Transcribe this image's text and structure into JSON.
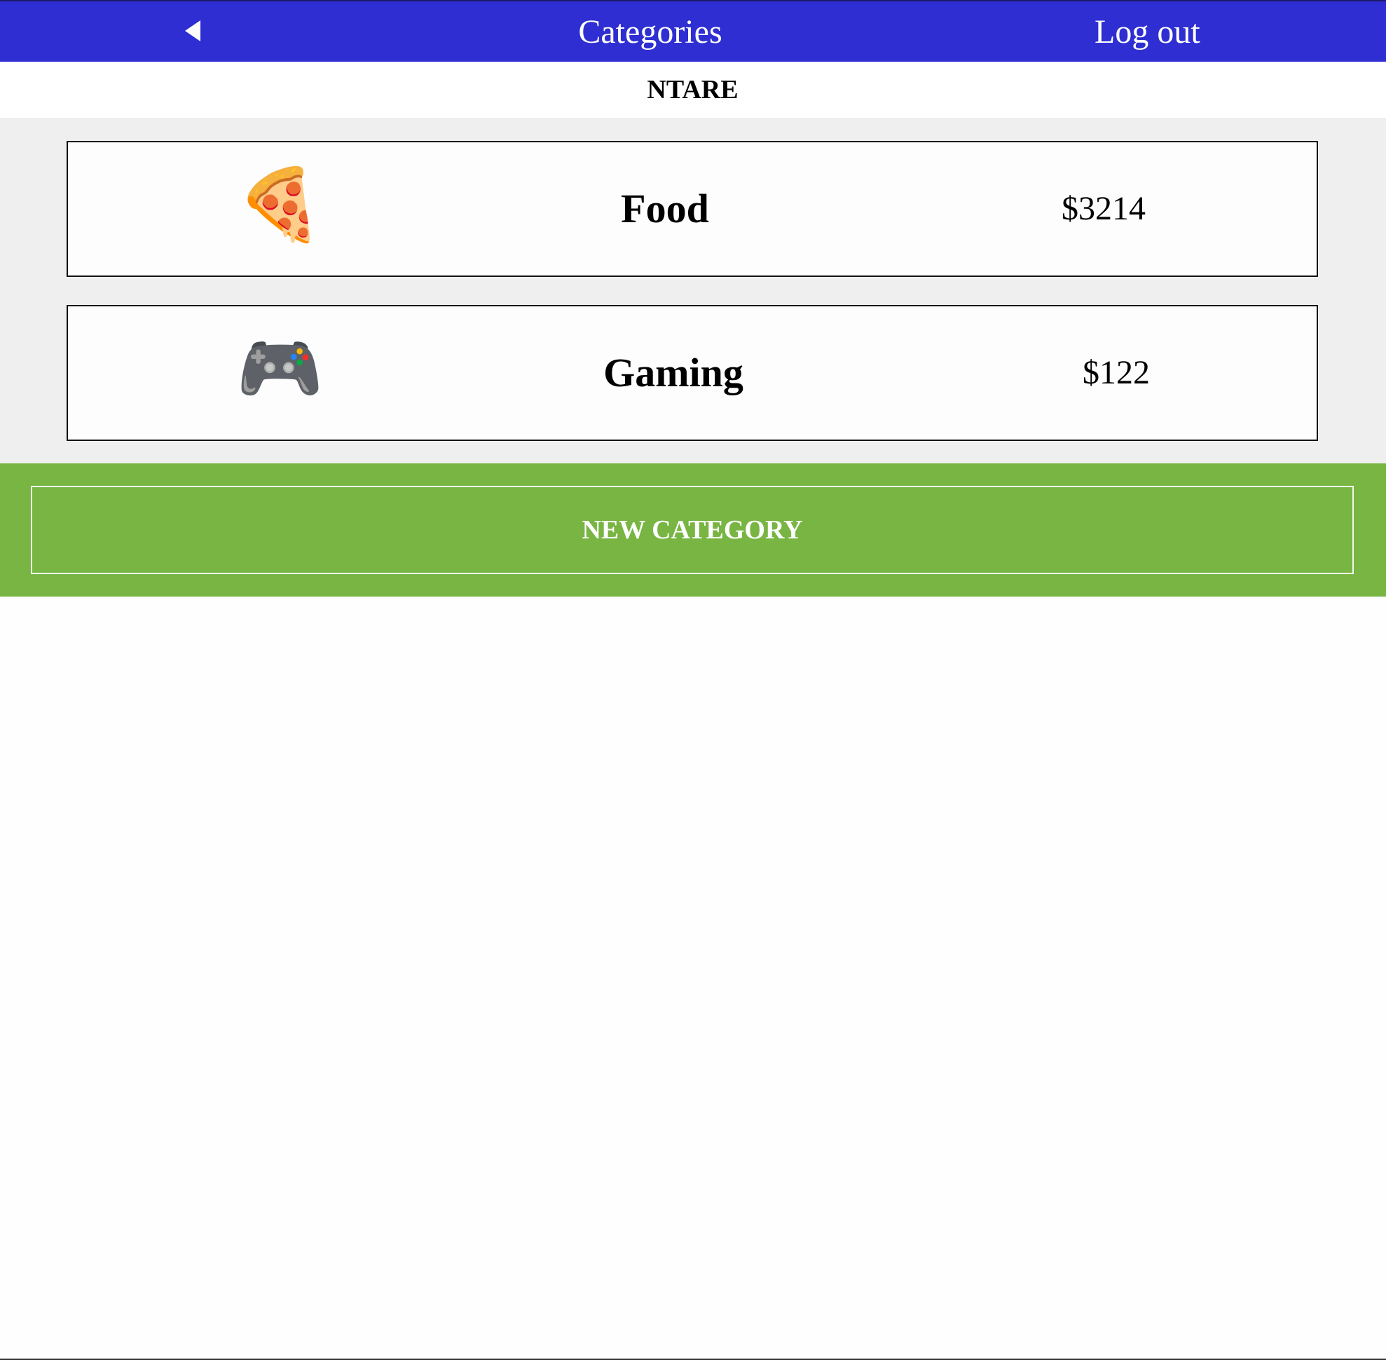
{
  "navbar": {
    "back_icon": "triangle-left-icon",
    "title": "Categories",
    "logout_label": "Log out",
    "color": "#2e2ed2"
  },
  "user": {
    "name": "NTARE"
  },
  "categories": [
    {
      "icon": "🍕",
      "icon_name": "pizza-icon",
      "name": "Food",
      "amount": "$3214"
    },
    {
      "icon": "🎮",
      "icon_name": "game-controller-icon",
      "name": "Gaming",
      "amount": "$122"
    }
  ],
  "actions": {
    "new_category_label": "NEW CATEGORY",
    "color": "#78b543"
  }
}
